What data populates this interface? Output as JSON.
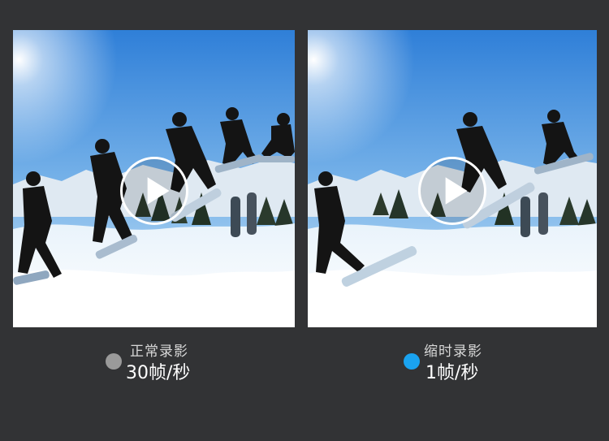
{
  "colors": {
    "background": "#323335",
    "normal_dot": "#9a9a9a",
    "timelapse_dot": "#1aa3f0"
  },
  "panels": [
    {
      "video": "snowboard-multi-exposure-video",
      "play_icon": "play-icon",
      "caption_title": "正常录影",
      "caption_value": "30帧/秒",
      "dot_color": "#9a9a9a"
    },
    {
      "video": "snowboard-multi-exposure-video",
      "play_icon": "play-icon",
      "caption_title": "缩时录影",
      "caption_value": "1帧/秒",
      "dot_color": "#1aa3f0"
    }
  ]
}
